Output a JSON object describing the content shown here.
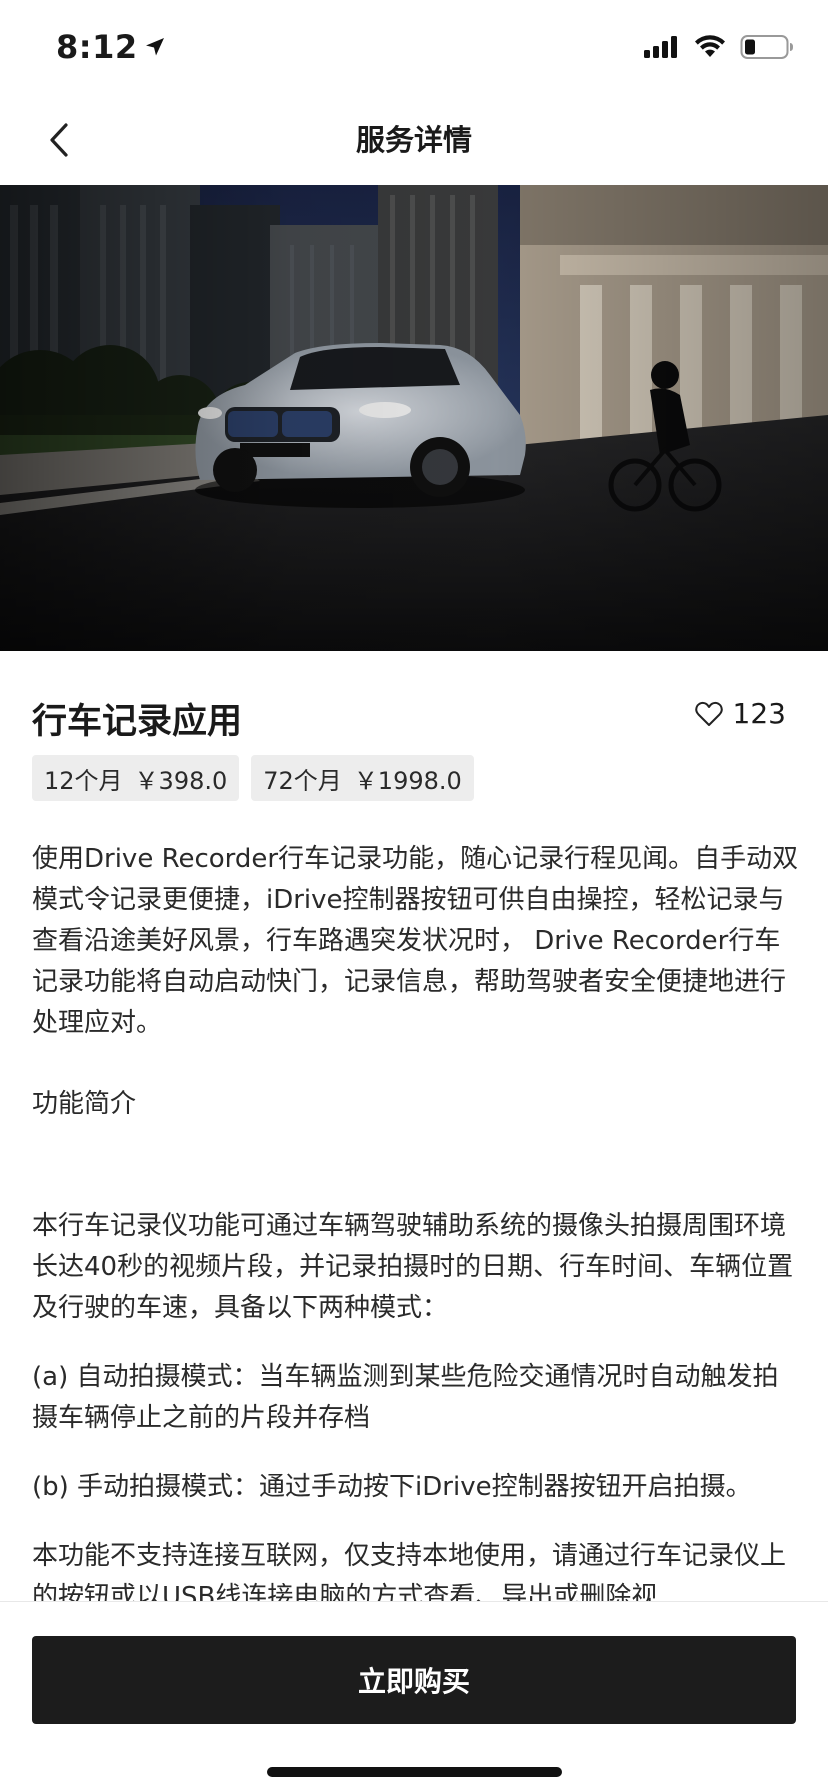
{
  "status_bar": {
    "time": "8:12"
  },
  "nav": {
    "title": "服务详情"
  },
  "product": {
    "title": "行车记录应用",
    "likes": "123",
    "prices": [
      {
        "duration": "12个月",
        "price": "￥398.0"
      },
      {
        "duration": "72个月",
        "price": "￥1998.0"
      }
    ]
  },
  "description": {
    "intro": "使用Drive Recorder行车记录功能，随心记录行程见闻。自手动双模式令记录更便捷，iDrive控制器按钮可供自由操控，轻松记录与查看沿途美好风景，行车路遇突发状况时， Drive Recorder行车记录功能将自动启动快门，记录信息，帮助驾驶者安全便捷地进行处理应对。",
    "section_title": "功能简介",
    "para1": "本行车记录仪功能可通过车辆驾驶辅助系统的摄像头拍摄周围环境长达40秒的视频片段，并记录拍摄时的日期、行车时间、车辆位置及行驶的车速，具备以下两种模式：",
    "mode_a": "(a) 自动拍摄模式：当车辆监测到某些危险交通情况时自动触发拍摄车辆停止之前的片段并存档",
    "mode_b": "(b) 手动拍摄模式：通过手动按下iDrive控制器按钮开启拍摄。",
    "para2": "本功能不支持连接互联网，仅支持本地使用，请通过行车记录仪上的按钮或以USB线连接电脑的方式查看、导出或删除视"
  },
  "actions": {
    "buy_label": "立即购买"
  },
  "icons": {
    "back": "chevron-left-icon",
    "like": "heart-outline-icon",
    "location": "location-arrow-icon",
    "signal": "signal-icon",
    "wifi": "wifi-icon",
    "battery": "battery-icon"
  }
}
